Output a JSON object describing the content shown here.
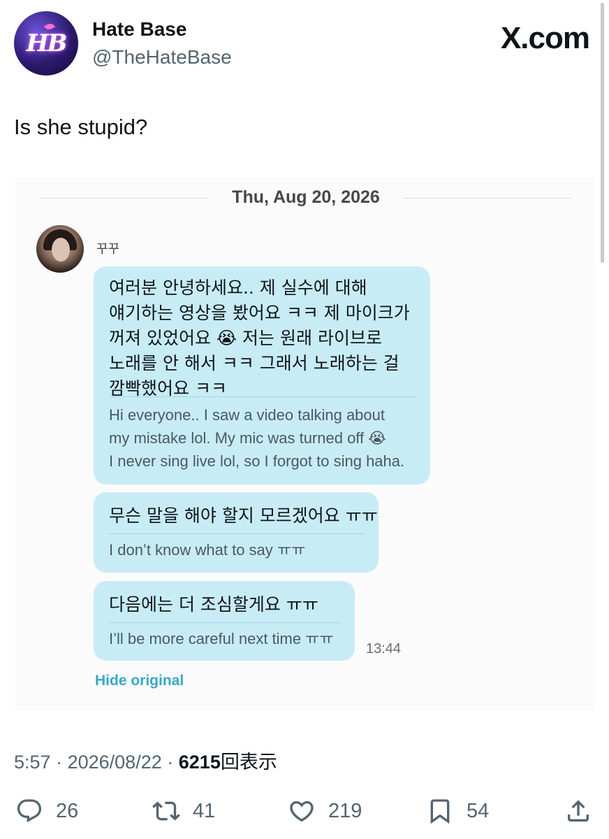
{
  "author": {
    "display_name": "Hate Base",
    "handle": "@TheHateBase",
    "avatar_text": "HB"
  },
  "brand": {
    "site": "X.com"
  },
  "tweet": {
    "text": "Is she stupid?"
  },
  "embedded": {
    "date": "Thu, Aug 20, 2026",
    "sender_name": "꾸꾸",
    "messages": [
      {
        "korean": "여러분 안녕하세요.. 제 실수에 대해\n얘기하는 영상을 봤어요 ㅋㅋ 제 마이크가\n꺼져 있었어요 😭 저는 원래 라이브로\n노래를 안 해서 ㅋㅋ 그래서 노래하는 걸\n깜빡했어요 ㅋㅋ",
        "english": "Hi everyone.. I saw a video talking about\nmy mistake lol. My mic was turned off 😭\nI never sing live lol, so I forgot to sing haha."
      },
      {
        "korean": "무슨 말을 해야 할지 모르겠어요 ㅠㅠ",
        "english": "I don’t know what to say ㅠㅠ"
      },
      {
        "korean": "다음에는 더 조심할게요 ㅠㅠ",
        "english": "I’ll be more careful next time ㅠㅠ"
      }
    ],
    "time": "13:44",
    "hide_original": "Hide original"
  },
  "meta": {
    "time": "5:57",
    "sep": "·",
    "date": "2026/08/22",
    "views": "6215",
    "views_label": "回表示"
  },
  "actions": {
    "replies": "26",
    "reposts": "41",
    "likes": "219",
    "bookmarks": "54"
  },
  "icons": {
    "reply": "reply-icon",
    "repost": "repost-icon",
    "like": "heart-icon",
    "bookmark": "bookmark-icon",
    "share": "share-icon"
  }
}
